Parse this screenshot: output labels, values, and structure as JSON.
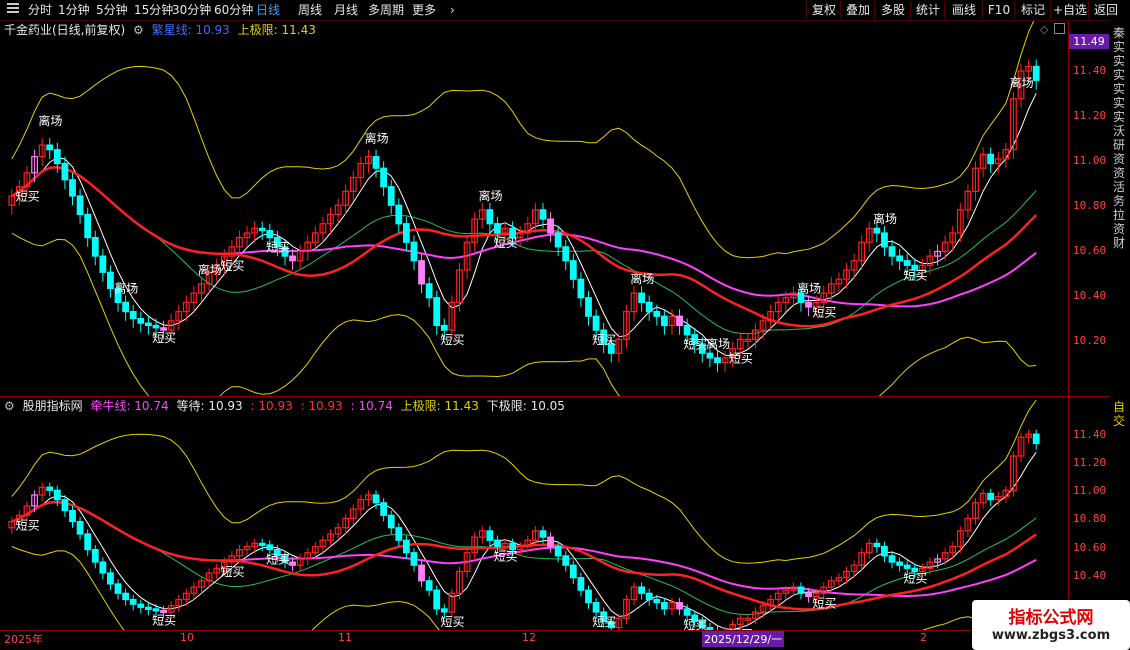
{
  "toolbar": {
    "periods": [
      "分时",
      "1分钟",
      "5分钟",
      "15分钟",
      "30分钟",
      "60分钟",
      "日线",
      "周线",
      "月线",
      "多周期",
      "更多"
    ],
    "active_period": "日线",
    "more_arrow": "›",
    "right_buttons": [
      "复权",
      "叠加",
      "多股",
      "统计",
      "画线",
      "F10",
      "标记",
      "+自选",
      "返回"
    ]
  },
  "main_pane": {
    "stock_title": "千金药业(日线,前复权)",
    "indicator_label": "繁星线: 10.93",
    "limit_label": "上极限: 11.43",
    "price_tag": "11.49",
    "ticks": [
      "11.40",
      "11.20",
      "11.00",
      "10.80",
      "10.60",
      "10.40",
      "10.20"
    ],
    "buy_label": "短买",
    "exit_label": "离场"
  },
  "sub_pane": {
    "indicator_name": "股朋指标网",
    "values": [
      "牵牛线: 10.74",
      "等待: 10.93",
      ": 10.93",
      ": 10.93",
      ": 10.74",
      "上极限: 11.43",
      "下极限: 10.05"
    ],
    "ticks": [
      "11.40",
      "11.20",
      "11.00",
      "10.80",
      "10.60",
      "10.40"
    ]
  },
  "x_axis": {
    "labels": [
      "2025年",
      "10",
      "11",
      "12",
      "2025/12/29/一",
      "2"
    ]
  },
  "right_strip": {
    "text1": "秦实实实实实实沃研资资活务拉资财",
    "text2": "自交"
  },
  "colors": {
    "up": "#ff2020",
    "down": "#00ffff",
    "bias": "#ff80ff",
    "ma_red": "#ff2020",
    "ma_magenta": "#ff40ff",
    "band": "#e6d000",
    "mid": "#20c060"
  },
  "watermark": {
    "line1": "指标公式网",
    "line2": "www.zbgs3.com"
  },
  "chart_data": {
    "type": "candlestick",
    "title": "千金药业(日线,前复权)",
    "ylim": [
      10.05,
      11.55
    ],
    "closes": [
      10.88,
      10.92,
      10.98,
      11.05,
      11.1,
      11.08,
      11.02,
      10.95,
      10.88,
      10.8,
      10.7,
      10.62,
      10.55,
      10.48,
      10.42,
      10.38,
      10.35,
      10.33,
      10.32,
      10.31,
      10.3,
      10.34,
      10.38,
      10.42,
      10.46,
      10.5,
      10.55,
      10.58,
      10.62,
      10.66,
      10.7,
      10.72,
      10.74,
      10.73,
      10.7,
      10.66,
      10.62,
      10.6,
      10.64,
      10.68,
      10.72,
      10.76,
      10.8,
      10.84,
      10.9,
      10.96,
      11.02,
      11.05,
      11.0,
      10.92,
      10.84,
      10.76,
      10.68,
      10.6,
      10.5,
      10.44,
      10.32,
      10.3,
      10.42,
      10.56,
      10.68,
      10.78,
      10.82,
      10.76,
      10.72,
      10.74,
      10.7,
      10.72,
      10.76,
      10.82,
      10.78,
      10.72,
      10.66,
      10.6,
      10.52,
      10.44,
      10.36,
      10.3,
      10.24,
      10.2,
      10.26,
      10.38,
      10.46,
      10.42,
      10.38,
      10.36,
      10.32,
      10.36,
      10.32,
      10.28,
      10.24,
      10.2,
      10.18,
      10.16,
      10.18,
      10.22,
      10.26,
      10.26,
      10.3,
      10.34,
      10.38,
      10.42,
      10.44,
      10.46,
      10.42,
      10.4,
      10.42,
      10.46,
      10.5,
      10.52,
      10.56,
      10.6,
      10.68,
      10.74,
      10.72,
      10.66,
      10.62,
      10.6,
      10.58,
      10.56,
      10.58,
      10.62,
      10.64,
      10.68,
      10.72,
      10.82,
      10.9,
      11.0,
      11.06,
      11.02,
      11.04,
      11.08,
      11.3,
      11.42,
      11.44,
      11.38
    ]
  }
}
